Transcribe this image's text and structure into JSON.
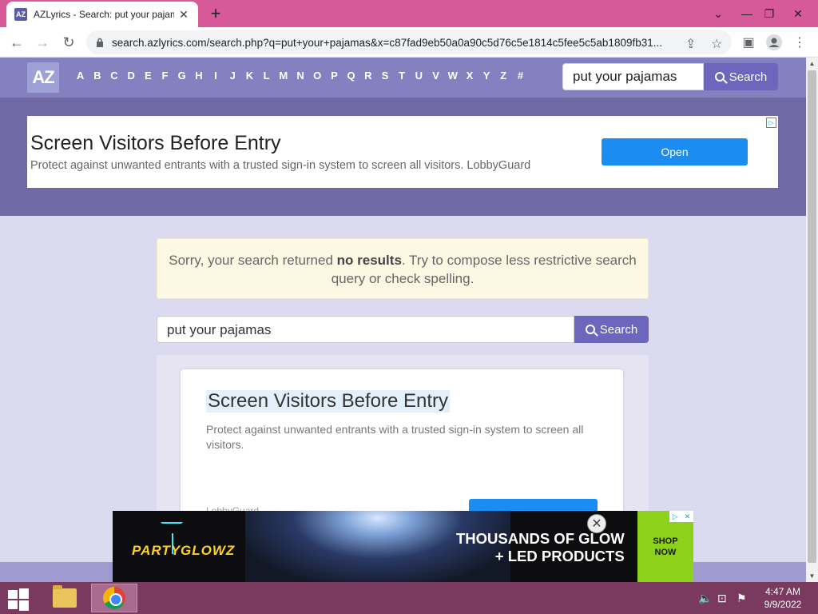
{
  "browser": {
    "tab_title": "AZLyrics - Search: put your pajamas",
    "tab_favicon": "AZ",
    "url": "search.azlyrics.com/search.php?q=put+your+pajamas&x=c87fad9eb50a0a90c5d76c5e1814c5fee5c5ab1809fb31..."
  },
  "site": {
    "logo": "AZ",
    "letters": [
      "A",
      "B",
      "C",
      "D",
      "E",
      "F",
      "G",
      "H",
      "I",
      "J",
      "K",
      "L",
      "M",
      "N",
      "O",
      "P",
      "Q",
      "R",
      "S",
      "T",
      "U",
      "V",
      "W",
      "X",
      "Y",
      "Z",
      "#"
    ],
    "header_search_value": "put your pajamas",
    "search_button": "Search"
  },
  "top_ad": {
    "title": "Screen Visitors Before Entry",
    "description": "Protect against unwanted entrants with a trusted sign-in system to screen all visitors. LobbyGuard",
    "button": "Open"
  },
  "results": {
    "message_prefix": "Sorry, your search returned ",
    "message_bold": "no results",
    "message_suffix": ". Try to compose less restrictive search query or check spelling.",
    "search_value": "put your pajamas",
    "search_button": "Search"
  },
  "inline_ad": {
    "title": "Screen Visitors Before Entry",
    "description": "Protect against unwanted entrants with a trusted sign-in system to screen all visitors.",
    "source": "LobbyGuard"
  },
  "bottom_ad": {
    "brand": "PARTYGLOWZ",
    "headline_1": "THOUSANDS OF GLOW",
    "headline_2": "+ LED PRODUCTS",
    "cta_1": "SHOP",
    "cta_2": "NOW"
  },
  "taskbar": {
    "time": "4:47 AM",
    "date": "9/9/2022"
  }
}
